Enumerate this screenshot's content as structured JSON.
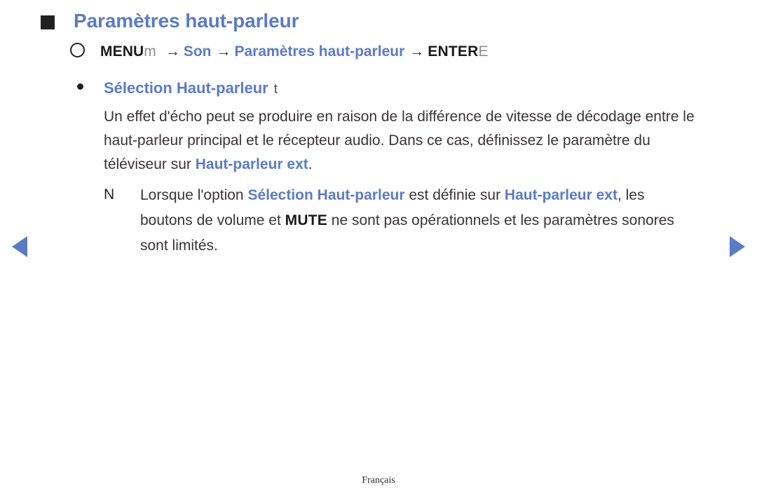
{
  "page": {
    "background_color": "#ffffff",
    "accent_color": "#5b7bc4",
    "text_color": "#3a3336"
  },
  "title": {
    "marker": "square-marker",
    "text": "Paramètres haut-parleur"
  },
  "menu_path": {
    "circle_glyph": "O",
    "key_label": "MENU",
    "key_symbol": "m",
    "arrow": "→",
    "step1": "Son",
    "step2": "Paramètres haut-parleur",
    "enter_label": "ENTER",
    "enter_symbol": "E"
  },
  "section": {
    "bullet": "●",
    "label": "Sélection Haut-parleur",
    "symbol": "t"
  },
  "body": {
    "part1": "Un effet d'écho peut se produire en raison de la différence de vitesse de décodage entre le haut-parleur principal et le récepteur audio. Dans ce cas, définissez le paramètre du téléviseur sur ",
    "highlight1": "Haut-parleur ext",
    "part2": "."
  },
  "note": {
    "marker": "N",
    "part1": "Lorsque l'option ",
    "highlight1": "Sélection Haut-parleur",
    "part2": " est définie sur ",
    "highlight2": "Haut-parleur ext",
    "part3": ", les boutons de volume et ",
    "bold1": "MUTE",
    "part4": " ne sont pas opérationnels et les paramètres sonores sont limités."
  },
  "nav": {
    "previous": "◀",
    "next": "▶"
  },
  "footer": {
    "language": "Français"
  }
}
